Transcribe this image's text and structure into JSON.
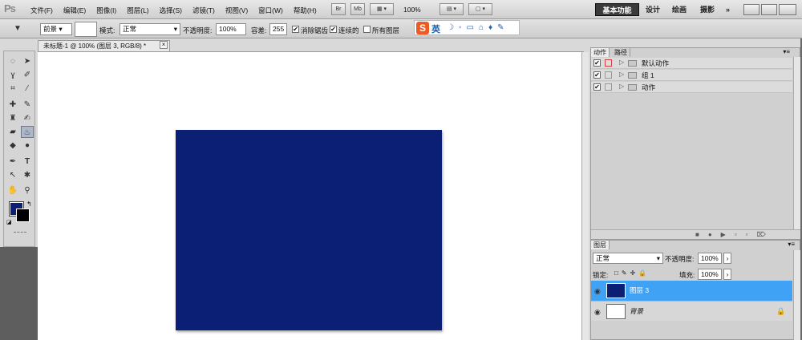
{
  "app": {
    "logo": "Ps"
  },
  "menu": [
    "文件(F)",
    "编辑(E)",
    "图像(I)",
    "图层(L)",
    "选择(S)",
    "滤镜(T)",
    "视图(V)",
    "窗口(W)",
    "帮助(H)"
  ],
  "app_bar": {
    "br_label": "Br",
    "mb_label": "Mb",
    "zoom": "100%"
  },
  "workspaces": {
    "active": "基本功能",
    "design": "设计",
    "painting": "绘画",
    "photo": "摄影",
    "more": "»"
  },
  "options": {
    "fill_source": "前景",
    "mode_label": "模式:",
    "mode_value": "正常",
    "opacity_label": "不透明度:",
    "opacity_value": "100%",
    "tolerance_label": "容差:",
    "tolerance_value": "255",
    "antialias_label": "消除锯齿",
    "contiguous_label": "连续的",
    "all_layers_label": "所有图层"
  },
  "ime": {
    "logo": "S",
    "lang": "英"
  },
  "document": {
    "tab_title": "未标题-1 @ 100% (图层 3, RGB/8) *",
    "close": "×"
  },
  "colors": {
    "foreground": "#0c1f77",
    "background": "#000000",
    "canvas_fill": "#0b1f74",
    "layer_highlight": "#3fa2f5"
  },
  "actions_panel": {
    "tabs": [
      "动作",
      "路径"
    ],
    "rows": [
      {
        "label": "默认动作",
        "checked": "✔"
      },
      {
        "label": "组 1",
        "checked": "✔"
      },
      {
        "label": "动作",
        "checked": "✔"
      }
    ]
  },
  "layers_panel": {
    "tab": "图层",
    "blend_mode": "正常",
    "opacity_label": "不透明度:",
    "opacity_value": "100%",
    "lock_label": "锁定:",
    "fill_label": "填充:",
    "fill_value": "100%",
    "layers": [
      {
        "name": "图层 3",
        "selected": true
      },
      {
        "name": "背景",
        "selected": false,
        "locked": true
      }
    ]
  }
}
